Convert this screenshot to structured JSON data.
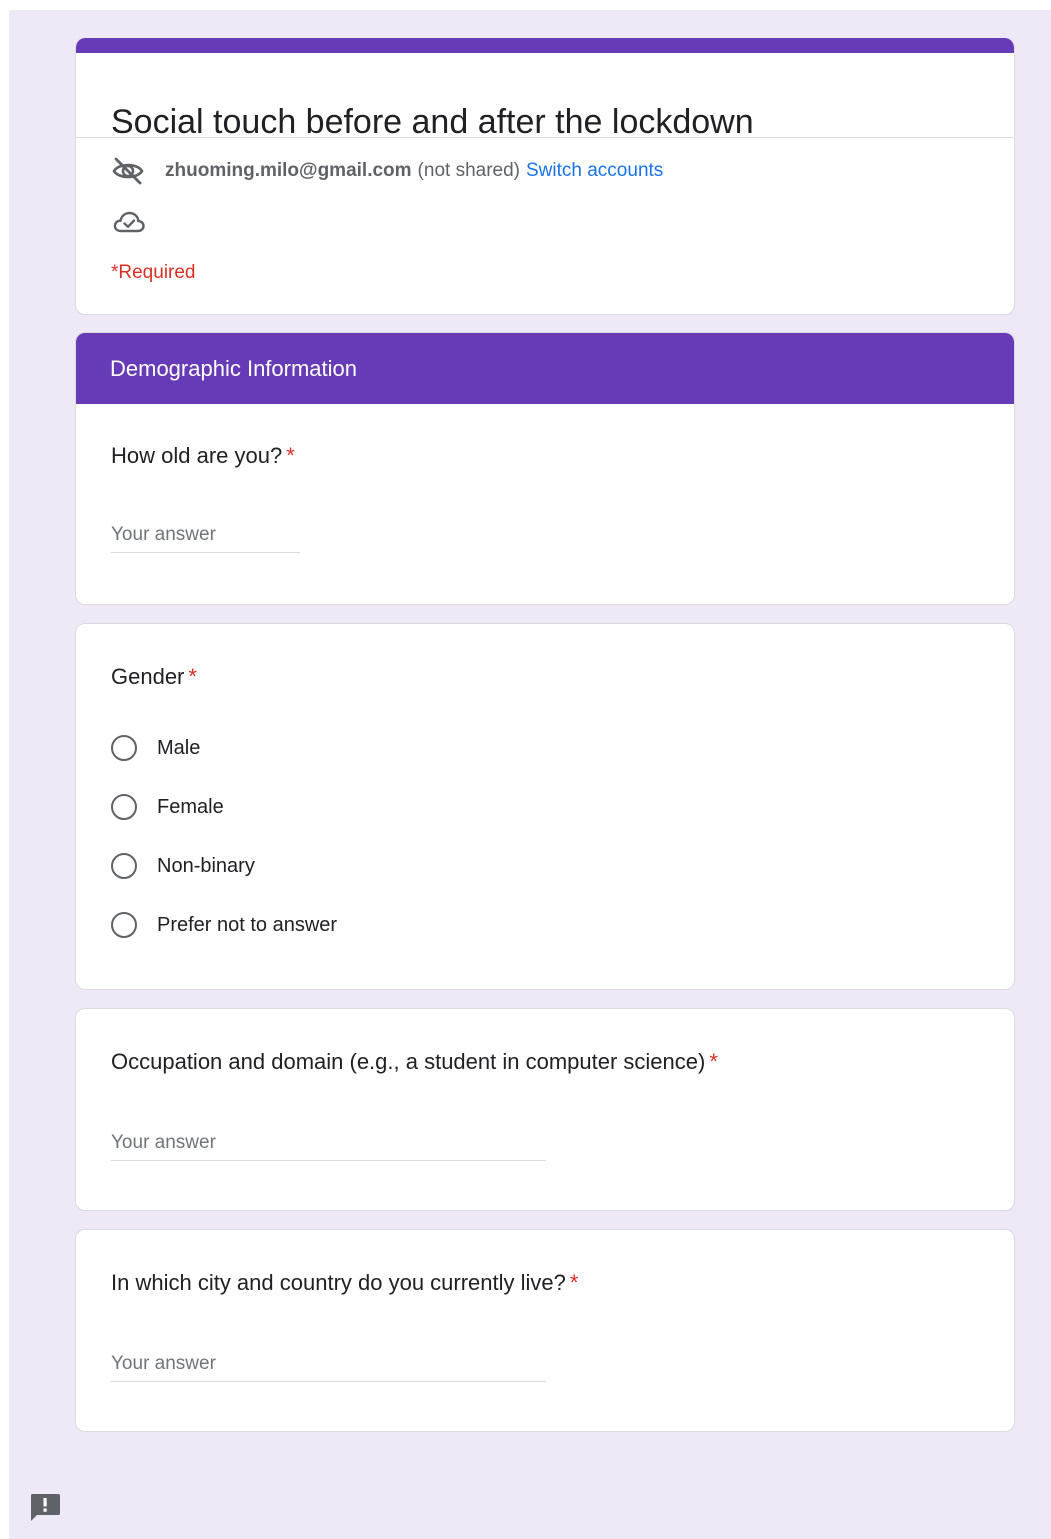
{
  "form": {
    "title": "Social touch before and after the lockdown",
    "account_email": "zhuoming.milo@gmail.com",
    "not_shared": "(not shared)",
    "switch_accounts": "Switch accounts",
    "required_note": "*Required"
  },
  "section": {
    "title": "Demographic Information"
  },
  "questions": {
    "age": {
      "title": "How old are you?",
      "required_mark": "*",
      "placeholder": "Your answer"
    },
    "gender": {
      "title": "Gender",
      "required_mark": "*",
      "options": [
        "Male",
        "Female",
        "Non-binary",
        "Prefer not to answer"
      ]
    },
    "occupation": {
      "title": "Occupation and domain (e.g., a student in computer science)",
      "required_mark": "*",
      "placeholder": "Your answer"
    },
    "city": {
      "title": "In which city and country do you currently live?",
      "required_mark": "*",
      "placeholder": "Your answer"
    }
  },
  "icons": {
    "visibility": "eye-off-icon",
    "cloud": "cloud-done-icon",
    "feedback": "report-feedback-icon"
  },
  "colors": {
    "accent": "#673ab7",
    "background": "#efe8f6",
    "required": "#d93025",
    "link": "#1a73e8"
  }
}
